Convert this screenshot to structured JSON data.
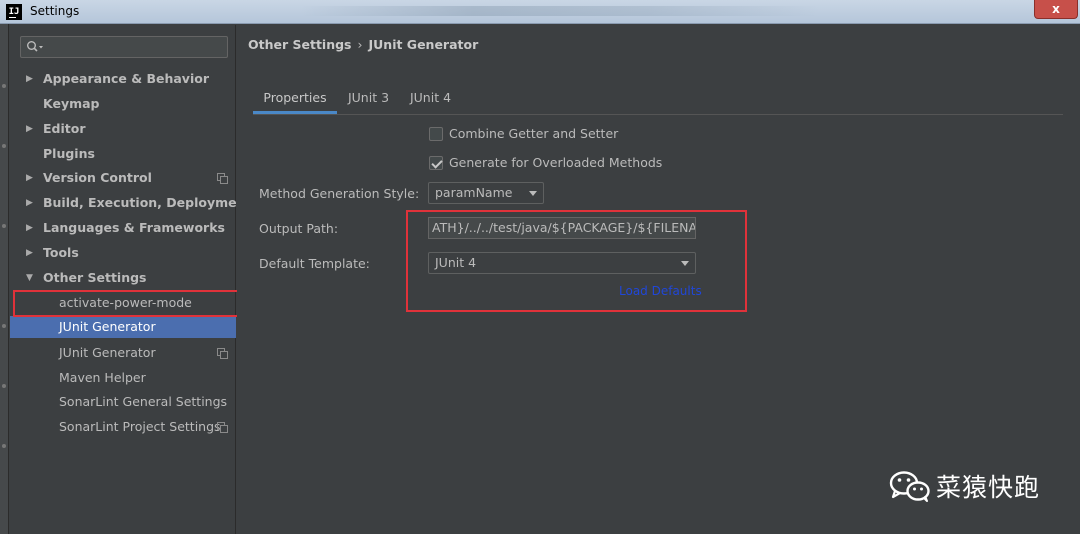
{
  "window": {
    "title": "Settings",
    "close_label": "x",
    "app_icon_label": "IJ"
  },
  "sidebar": {
    "search_placeholder": "Q▾",
    "items": [
      {
        "label": "Appearance & Behavior"
      },
      {
        "label": "Keymap"
      },
      {
        "label": "Editor"
      },
      {
        "label": "Plugins"
      },
      {
        "label": "Version Control"
      },
      {
        "label": "Build, Execution, Deployment"
      },
      {
        "label": "Languages & Frameworks"
      },
      {
        "label": "Tools"
      },
      {
        "label": "Other Settings"
      },
      {
        "label": "activate-power-mode"
      },
      {
        "label": "JUnit Generator"
      },
      {
        "label": "JUnit Generator"
      },
      {
        "label": "Maven Helper"
      },
      {
        "label": "SonarLint General Settings"
      },
      {
        "label": "SonarLint Project Settings"
      }
    ]
  },
  "main": {
    "breadcrumb": {
      "parent": "Other Settings",
      "separator": "›",
      "current": "JUnit Generator"
    },
    "tabs": [
      "Properties",
      "JUnit 3",
      "JUnit 4"
    ],
    "combine_getter_setter": {
      "label": "Combine Getter and Setter",
      "checked": false
    },
    "generate_overloaded": {
      "label": "Generate for Overloaded Methods",
      "checked": true
    },
    "method_generation_style": {
      "label": "Method Generation Style:",
      "value": "paramName"
    },
    "output_path": {
      "label": "Output Path:",
      "value": "ATH}/../../test/java/${PACKAGE}/${FILENAME}"
    },
    "default_template": {
      "label": "Default Template:",
      "value": "JUnit 4"
    },
    "load_defaults": "Load Defaults"
  },
  "watermark": {
    "text": "菜猿快跑"
  },
  "colors": {
    "background": "#3c3f41",
    "selection": "#4b6eaf",
    "highlight_box": "#e0323a",
    "link": "#2047d9",
    "tab_underline": "#4a88c7"
  }
}
